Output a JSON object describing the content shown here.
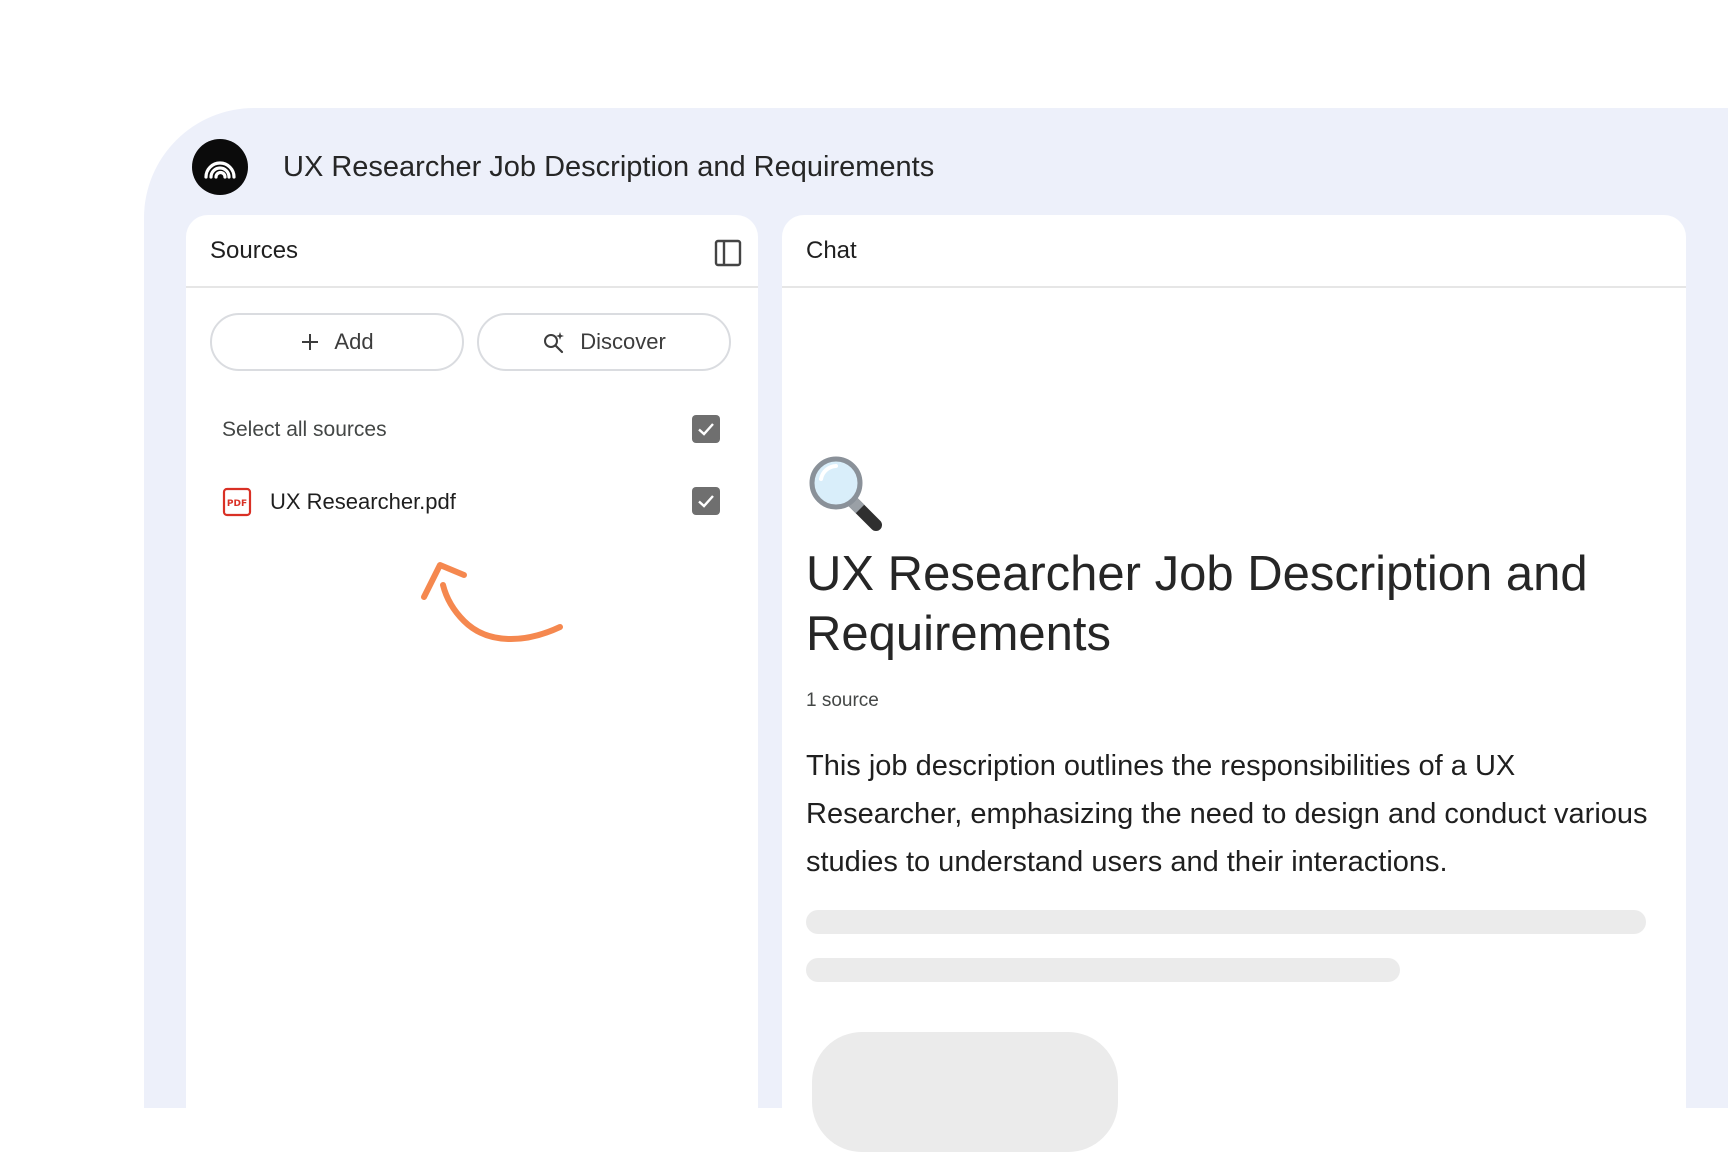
{
  "app": {
    "title": "UX Researcher Job Description and Requirements",
    "logo_icon": "notebooklm-logo-icon"
  },
  "sources": {
    "panel_title": "Sources",
    "collapse_icon": "panel-collapse-icon",
    "add_label": "Add",
    "discover_label": "Discover",
    "select_all_label": "Select all sources",
    "select_all_checked": true,
    "files": [
      {
        "name": "UX Researcher.pdf",
        "icon": "pdf-icon",
        "checked": true
      }
    ]
  },
  "chat": {
    "panel_title": "Chat",
    "emoji_icon": "magnifying-glass-icon",
    "heading": "UX Researcher Job Description and Requirements",
    "source_count": "1 source",
    "summary": "This job description outlines the responsibilities of a UX Researcher, emphasizing the need to design and conduct various studies to understand users and their interactions."
  },
  "colors": {
    "frame_bg": "#edf0fa",
    "annotation_arrow": "#f5884f",
    "checkbox": "#6f6f6f",
    "pdf_red": "#d93025",
    "skeleton": "#ebebeb"
  }
}
